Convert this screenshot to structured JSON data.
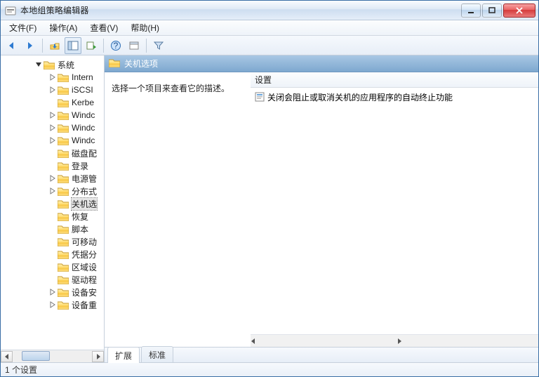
{
  "window": {
    "title": "本地组策略编辑器"
  },
  "menu": {
    "file": "文件(F)",
    "action": "操作(A)",
    "view": "查看(V)",
    "help": "帮助(H)"
  },
  "toolbar_icons": {
    "back": "back-arrow-icon",
    "forward": "forward-arrow-icon",
    "up": "up-folder-icon",
    "show_tree": "show-tree-icon",
    "export": "export-list-icon",
    "help": "help-icon",
    "props": "properties-icon",
    "filter": "filter-icon"
  },
  "tree": {
    "root": {
      "label": "系统",
      "children": [
        {
          "label": "Intern",
          "expandable": true
        },
        {
          "label": "iSCSI",
          "expandable": true
        },
        {
          "label": "Kerbe",
          "expandable": false
        },
        {
          "label": "Windc",
          "expandable": true
        },
        {
          "label": "Windc",
          "expandable": true
        },
        {
          "label": "Windc",
          "expandable": true
        },
        {
          "label": "磁盘配",
          "expandable": false
        },
        {
          "label": "登录",
          "expandable": false
        },
        {
          "label": "电源管",
          "expandable": true
        },
        {
          "label": "分布式",
          "expandable": true
        },
        {
          "label": "关机选",
          "expandable": false,
          "selected": true
        },
        {
          "label": "恢复",
          "expandable": false
        },
        {
          "label": "脚本",
          "expandable": false
        },
        {
          "label": "可移动",
          "expandable": false
        },
        {
          "label": "凭据分",
          "expandable": false
        },
        {
          "label": "区域设",
          "expandable": false
        },
        {
          "label": "驱动程",
          "expandable": false
        },
        {
          "label": "设备安",
          "expandable": true
        },
        {
          "label": "设备重",
          "expandable": true
        }
      ]
    }
  },
  "right": {
    "header": "关机选项",
    "description_prompt": "选择一个项目来查看它的描述。",
    "column_header": "设置",
    "items": [
      {
        "label": "关闭会阻止或取消关机的应用程序的自动终止功能"
      }
    ]
  },
  "tabs": {
    "extended": "扩展",
    "standard": "标准"
  },
  "status": {
    "text": "1 个设置"
  }
}
